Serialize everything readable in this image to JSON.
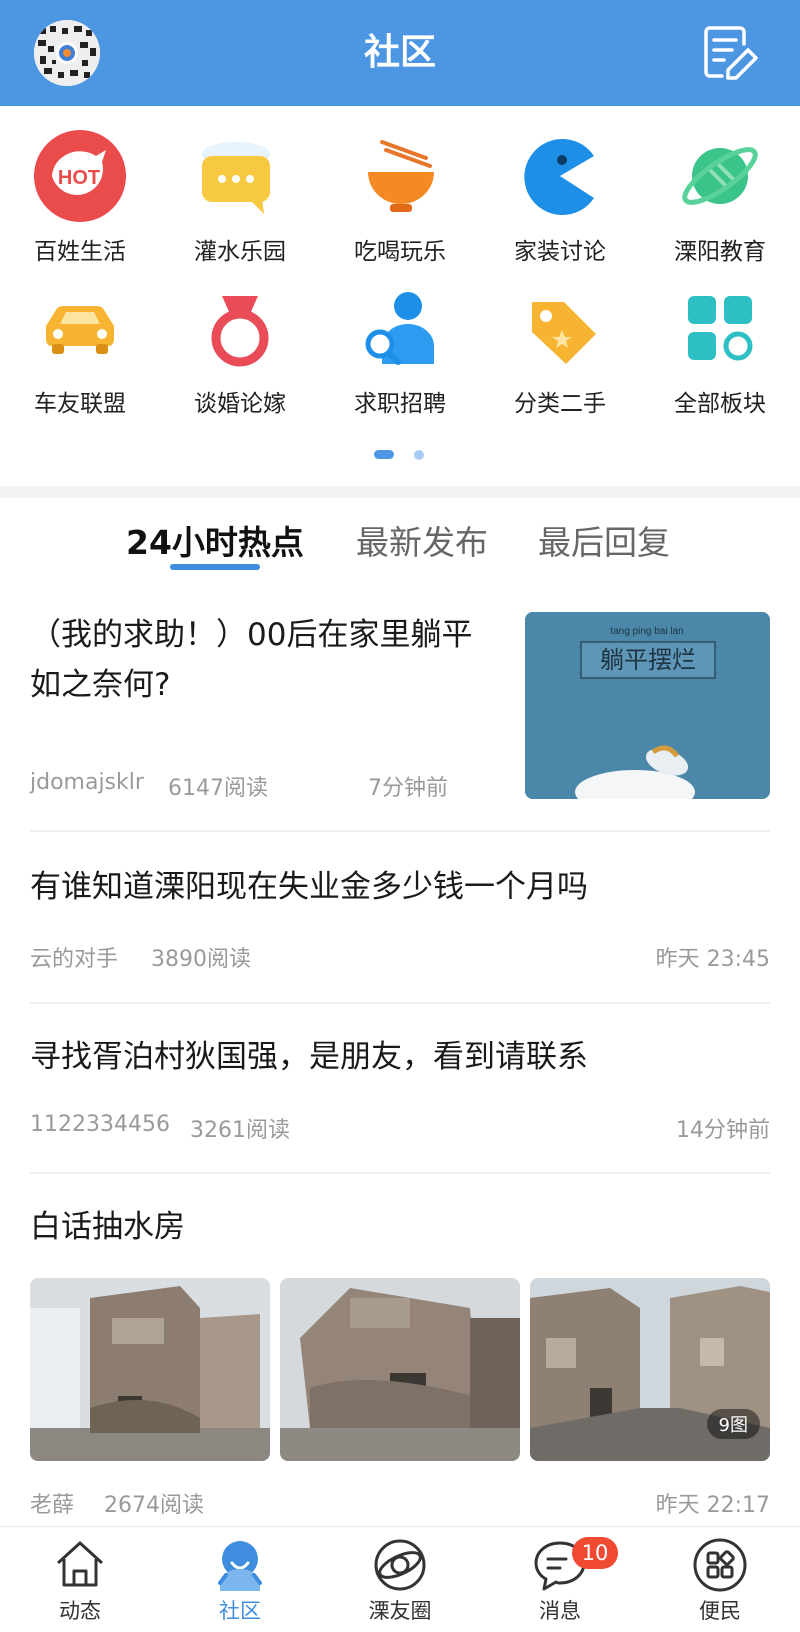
{
  "header": {
    "title": "社区",
    "compose_icon": "compose-icon",
    "avatar_icon": "avatar-icon"
  },
  "categories": [
    {
      "label": "百姓生活",
      "icon": "hot-icon"
    },
    {
      "label": "灌水乐园",
      "icon": "chat-icon"
    },
    {
      "label": "吃喝玩乐",
      "icon": "food-bowl-icon"
    },
    {
      "label": "家装讨论",
      "icon": "pacman-icon"
    },
    {
      "label": "溧阳教育",
      "icon": "planet-icon"
    },
    {
      "label": "车友联盟",
      "icon": "car-icon"
    },
    {
      "label": "谈婚论嫁",
      "icon": "ring-icon"
    },
    {
      "label": "求职招聘",
      "icon": "job-icon"
    },
    {
      "label": "分类二手",
      "icon": "tag-icon"
    },
    {
      "label": "全部板块",
      "icon": "grid-icon"
    }
  ],
  "tabs": [
    {
      "label": "24小时热点",
      "active": true
    },
    {
      "label": "最新发布",
      "active": false
    },
    {
      "label": "最后回复",
      "active": false
    }
  ],
  "posts": [
    {
      "title": "（我的求助！）00后在家里躺平如之奈何?",
      "author": "jdomajsklr",
      "reads": "6147阅读",
      "time": "7分钟前",
      "thumb_text": "躺平摆烂",
      "thumb_pinyin": "tang ping bai lan"
    },
    {
      "title": "有谁知道溧阳现在失业金多少钱一个月吗",
      "author": "云的对手",
      "reads": "3890阅读",
      "time": "昨天 23:45"
    },
    {
      "title": "寻找胥泊村狄国强，是朋友，看到请联系",
      "author": "1122334456",
      "reads": "3261阅读",
      "time": "14分钟前"
    },
    {
      "title": "白话抽水房",
      "author": "老薛",
      "reads": "2674阅读",
      "time": "昨天 22:17",
      "image_count": "9图"
    }
  ],
  "bottom_nav": [
    {
      "label": "动态",
      "icon": "home-icon",
      "active": false
    },
    {
      "label": "社区",
      "icon": "community-icon",
      "active": true
    },
    {
      "label": "溧友圈",
      "icon": "circle-icon",
      "active": false
    },
    {
      "label": "消息",
      "icon": "message-icon",
      "active": false,
      "badge": "10"
    },
    {
      "label": "便民",
      "icon": "services-icon",
      "active": false
    }
  ],
  "colors": {
    "brand": "#4d97e2",
    "active_tab": "#3f8ddf",
    "badge": "#f04a33"
  }
}
